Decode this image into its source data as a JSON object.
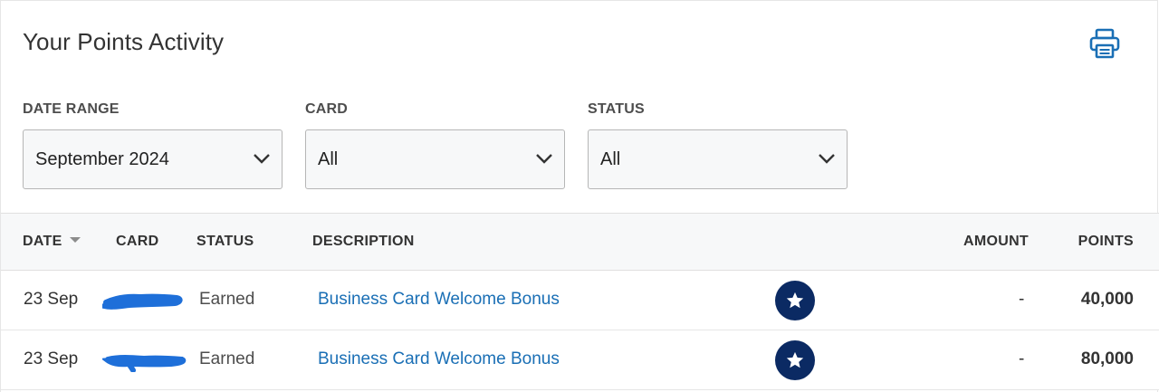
{
  "header": {
    "title": "Your Points Activity",
    "print_icon": "printer-icon"
  },
  "filters": [
    {
      "label": "DATE RANGE",
      "value": "September 2024"
    },
    {
      "label": "CARD",
      "value": "All"
    },
    {
      "label": "STATUS",
      "value": "All"
    }
  ],
  "table": {
    "columns": [
      "DATE",
      "CARD",
      "STATUS",
      "DESCRIPTION",
      "AMOUNT",
      "POINTS"
    ],
    "rows": [
      {
        "date": "23 Sep",
        "card": "",
        "status": "Earned",
        "description": "Business Card Welcome Bonus",
        "badge_icon": "star-icon",
        "amount": "-",
        "points": "40,000"
      },
      {
        "date": "23 Sep",
        "card": "",
        "status": "Earned",
        "description": "Business Card Welcome Bonus",
        "badge_icon": "star-icon",
        "amount": "-",
        "points": "80,000"
      }
    ]
  },
  "colors": {
    "link": "#1a6fb5",
    "badge": "#0b2a63",
    "print_icon": "#1a6fb5",
    "redaction": "#1e6fd9"
  }
}
